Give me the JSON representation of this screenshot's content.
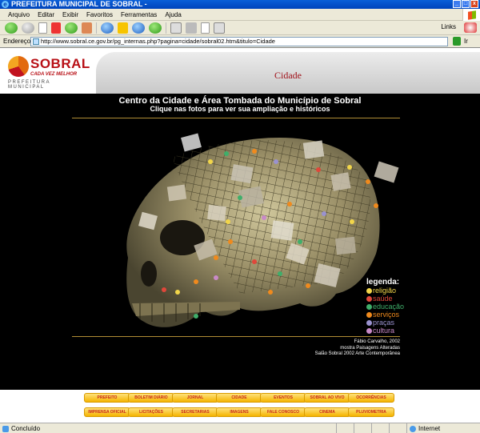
{
  "window": {
    "title": "PREFEITURA MUNICIPAL DE SOBRAL -"
  },
  "menu": [
    "Arquivo",
    "Editar",
    "Exibir",
    "Favoritos",
    "Ferramentas",
    "Ajuda"
  ],
  "toolbar": {
    "links_label": "Links"
  },
  "address": {
    "label": "Endereço",
    "url": "http://www.sobral.ce.gov.br/pg_internas.php?pagina=cidade/sobral02.htm&titulo=Cidade",
    "go_label": "Ir"
  },
  "header": {
    "logo_name": "SOBRAL",
    "logo_tagline": "CADA VEZ MELHOR",
    "logo_subtitle": "PREFEITURA MUNICIPAL",
    "page_title": "Cidade"
  },
  "content": {
    "title_line1": "Centro da Cidade e Área Tombada do Município de Sobral",
    "title_line2": "Clique nas fotos para ver sua ampliação e históricos",
    "credits": [
      "Fábio Carvalho, 2002",
      "mostra Paisagens Alteradas",
      "Salão Sobral 2002 Arte Contemporânea"
    ]
  },
  "legend": {
    "title": "legenda:",
    "items": [
      {
        "label": "religião",
        "color": "#f2d64a"
      },
      {
        "label": "saúde",
        "color": "#e0473a"
      },
      {
        "label": "educação",
        "color": "#3fae6a"
      },
      {
        "label": "serviços",
        "color": "#f08a1d"
      },
      {
        "label": "praças",
        "color": "#9a92cf"
      },
      {
        "label": "cultura",
        "color": "#c98ac8"
      }
    ]
  },
  "nav": {
    "row1": [
      "PREFEITO",
      "BOLETIM DIÁRIO",
      "JORNAL",
      "CIDADE",
      "EVENTOS",
      "SOBRAL AO VIVO",
      "OCORRÊNCIAS"
    ],
    "row2": [
      "IMPRENSA OFICIAL",
      "LICITAÇÕES",
      "SECRETARIAS",
      "IMAGENS",
      "FALE CONOSCO",
      "CINEMA",
      "PLUVIOMETRIA"
    ]
  },
  "status": {
    "text": "Concluído",
    "zone": "Internet"
  }
}
